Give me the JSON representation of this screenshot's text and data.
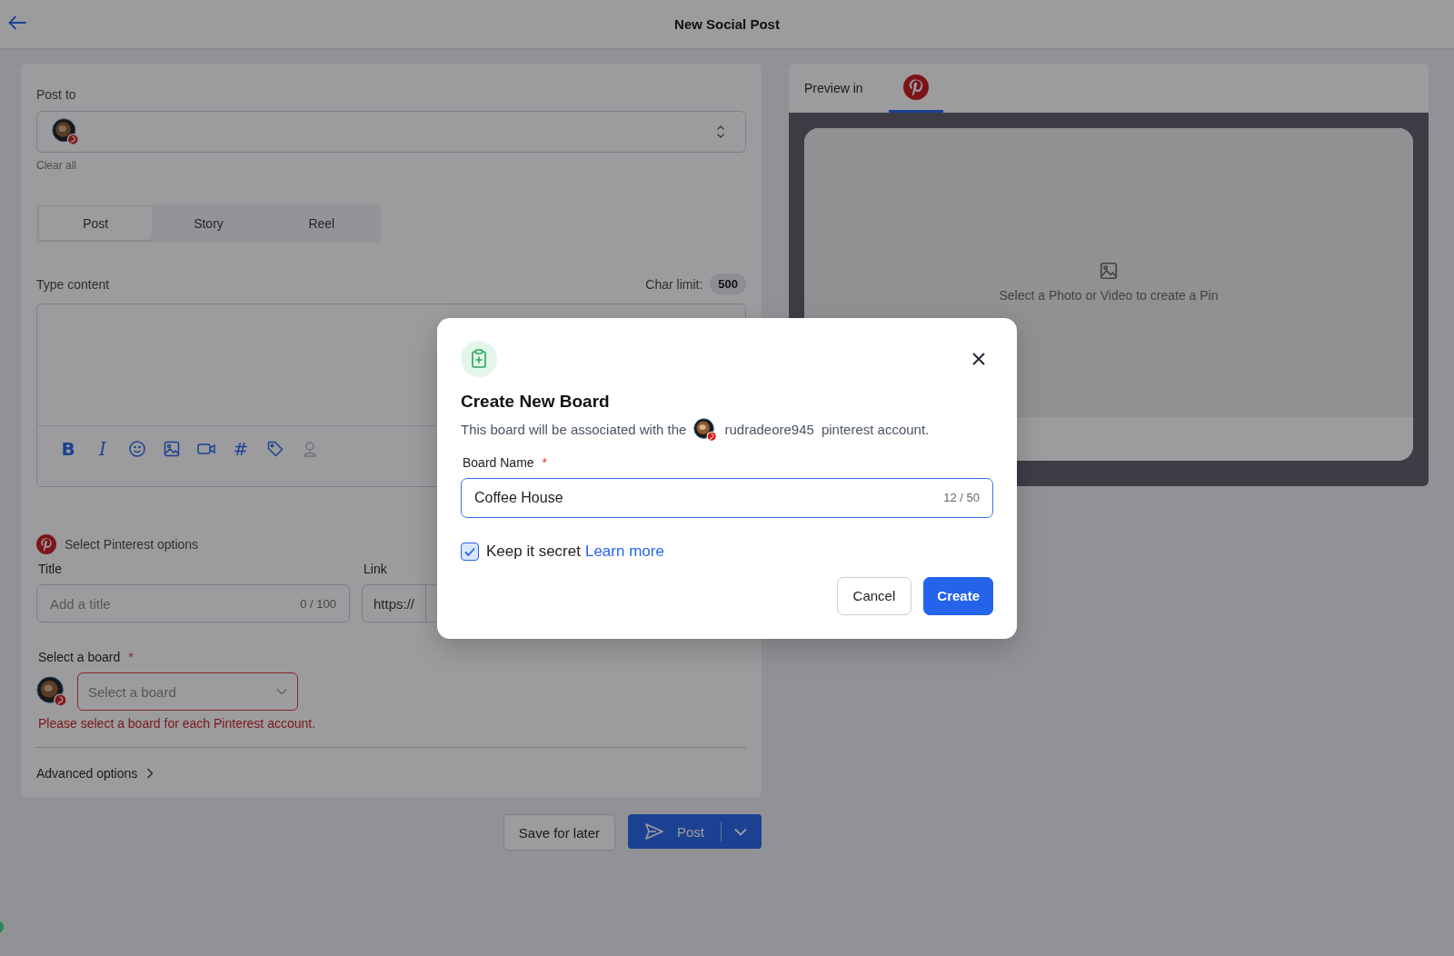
{
  "header": {
    "title": "New Social Post"
  },
  "composer": {
    "post_to_label": "Post to",
    "clear_all": "Clear all",
    "tabs": [
      {
        "label": "Post",
        "selected": true
      },
      {
        "label": "Story",
        "selected": false
      },
      {
        "label": "Reel",
        "selected": false
      }
    ],
    "content_label": "Type content",
    "char_limit_label": "Char limit:",
    "char_limit": "500",
    "toolbar": [
      {
        "kind": "bold",
        "glyph": "B",
        "disabled": false
      },
      {
        "kind": "italic",
        "glyph": "I",
        "disabled": false
      },
      {
        "kind": "emoji",
        "disabled": false
      },
      {
        "kind": "image",
        "disabled": false
      },
      {
        "kind": "video",
        "disabled": false
      },
      {
        "kind": "hashtag",
        "glyph": "#",
        "disabled": false
      },
      {
        "kind": "tag",
        "disabled": false
      },
      {
        "kind": "location",
        "disabled": true
      }
    ],
    "pinterest": {
      "heading": "Select Pinterest options",
      "title_label": "Title",
      "title_placeholder": "Add a title",
      "title_counter": "0 / 100",
      "link_label": "Link",
      "link_prefix": "https://",
      "board_label": "Select a board",
      "required_mark": "*",
      "board_placeholder": "Select a board",
      "error": "Please select a board for each Pinterest account."
    },
    "advanced": "Advanced options"
  },
  "actions": {
    "save": "Save for later",
    "post": "Post"
  },
  "preview": {
    "label": "Preview in",
    "tabs": [
      {
        "kind": "pinterest",
        "selected": true
      }
    ],
    "empty_text": "Select a Photo or Video to create a Pin"
  },
  "modal": {
    "title": "Create New Board",
    "description_prefix": "This board will be associated with the",
    "account": "rudradeore945",
    "description_suffix": "pinterest account.",
    "field_label": "Board Name",
    "required_mark": "*",
    "value": "Coffee House",
    "counter": "12 / 50",
    "secret": {
      "label": "Keep it secret",
      "checked": true,
      "link": "Learn more"
    },
    "buttons": [
      "Cancel",
      "Create"
    ]
  }
}
